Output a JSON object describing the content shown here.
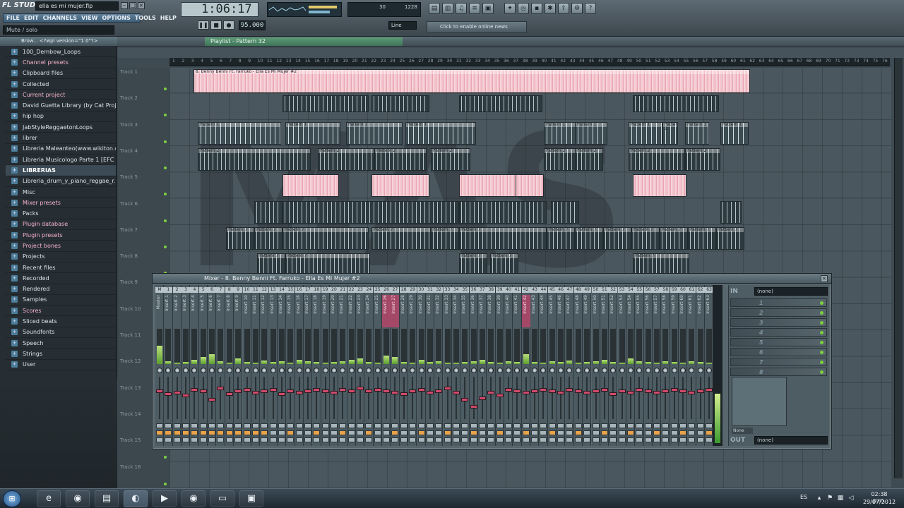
{
  "app": {
    "logo": "FL STUDIO",
    "project_file": "ella es mi mujer.flp",
    "hint": "Mute / solo",
    "menu": [
      "FILE",
      "EDIT",
      "CHANNELS",
      "VIEW",
      "OPTIONS",
      "TOOLS",
      "HELP"
    ],
    "time": "1:06:17",
    "tempo": "95.000",
    "cpu_a": "30",
    "cpu_b": "1228",
    "snap": "Line",
    "news": "Click to enable online news"
  },
  "browser": {
    "header": "Brow... <?wpl version=\"1.0\"?>",
    "items": [
      {
        "label": "100_Dembow_Loops",
        "hl": false
      },
      {
        "label": "Channel presets",
        "hl": true
      },
      {
        "label": "Clipboard files",
        "hl": false
      },
      {
        "label": "Collected",
        "hl": false
      },
      {
        "label": "Current project",
        "hl": true
      },
      {
        "label": "David Guetta Library (by Cat Proje...",
        "hl": false
      },
      {
        "label": "hip hop",
        "hl": false
      },
      {
        "label": "JabStyleReggaetonLoops",
        "hl": false
      },
      {
        "label": "librer",
        "hl": false
      },
      {
        "label": "Libreria Maleanteo(www.wikiton.o...",
        "hl": false
      },
      {
        "label": "Libreria Musicologo Parte 1 [EFC I...",
        "hl": false
      },
      {
        "label": "LIBRERIAS",
        "hl": false,
        "sel": true
      },
      {
        "label": "Libreria_drum_y_piano_reggae_r...",
        "hl": false
      },
      {
        "label": "Misc",
        "hl": false
      },
      {
        "label": "Mixer presets",
        "hl": true
      },
      {
        "label": "Packs",
        "hl": false
      },
      {
        "label": "Plugin database",
        "hl": true
      },
      {
        "label": "Plugin presets",
        "hl": true
      },
      {
        "label": "Project bones",
        "hl": true
      },
      {
        "label": "Projects",
        "hl": false
      },
      {
        "label": "Recent files",
        "hl": false
      },
      {
        "label": "Recorded",
        "hl": false
      },
      {
        "label": "Rendered",
        "hl": false
      },
      {
        "label": "Samples",
        "hl": false
      },
      {
        "label": "Scores",
        "hl": true
      },
      {
        "label": "Sliced beats",
        "hl": false
      },
      {
        "label": "Soundfonts",
        "hl": false
      },
      {
        "label": "Speech",
        "hl": false
      },
      {
        "label": "Strings",
        "hl": false
      },
      {
        "label": "User",
        "hl": false
      }
    ]
  },
  "playlist": {
    "title": "Playlist - Pattern 32",
    "ruler": [
      "1",
      "2",
      "3",
      "4",
      "5",
      "6",
      "7",
      "8",
      "9",
      "10",
      "11",
      "12",
      "13",
      "14",
      "15",
      "16",
      "17",
      "18",
      "19",
      "20",
      "21",
      "22",
      "23",
      "24",
      "25",
      "26",
      "27",
      "28",
      "29",
      "30",
      "31",
      "32",
      "33",
      "34",
      "35",
      "36",
      "37",
      "38",
      "39",
      "40",
      "41",
      "42",
      "43",
      "44",
      "45",
      "46",
      "47",
      "48",
      "49",
      "50",
      "51",
      "52",
      "53",
      "54",
      "55",
      "56",
      "57",
      "58",
      "59",
      "60",
      "61",
      "62",
      "63",
      "64",
      "65",
      "66",
      "67",
      "68",
      "69",
      "70",
      "71",
      "72",
      "73",
      "74",
      "75",
      "76"
    ],
    "tracks": [
      "Track 1",
      "Track 2",
      "Track 3",
      "Track 4",
      "Track 5",
      "Track 6",
      "Track 7",
      "Track 8",
      "Track 9",
      "Track 10",
      "Track 11",
      "Track 12",
      "Track 13",
      "Track 14",
      "Track 15",
      "Track 16"
    ],
    "audio_clip": "8. Benny Benni Ft. Farruko - Ella Es Mi Mujer #2",
    "pattern_clips": [
      "Pattern 1",
      "Pattern 2",
      "Pattern 7"
    ],
    "watermark": "MAS"
  },
  "mixer": {
    "title": "Mixer - 8. Benny Benni Ft. Farruko - Ella Es Mi Mujer #2",
    "strip_names": [
      "Master",
      "Insert 1",
      "Insert 2",
      "Insert 3",
      "Insert 4",
      "Insert 5",
      "Insert 6",
      "Insert 7",
      "Insert 8",
      "Insert 9",
      "Insert 10",
      "Insert 11",
      "Insert 12",
      "Insert 13",
      "Insert 14",
      "Insert 15",
      "Insert 16",
      "Insert 17",
      "Insert 18",
      "Insert 19",
      "Insert 20",
      "Insert 21",
      "Insert 22",
      "Insert 23",
      "Insert 24",
      "Insert 25",
      "Insert 26",
      "Insert 27",
      "Insert 28",
      "Insert 29",
      "Insert 30",
      "Insert 31",
      "Insert 32",
      "Insert 33",
      "Insert 34",
      "Insert 35",
      "Insert 36",
      "Insert 37",
      "Insert 38",
      "Insert 39",
      "Insert 40",
      "Insert 41",
      "Insert 42",
      "Insert 43",
      "Insert 44",
      "Insert 45",
      "Insert 46",
      "Insert 47",
      "Insert 48",
      "Insert 49",
      "Insert 50",
      "Insert 51",
      "Insert 52",
      "Insert 53",
      "Insert 54",
      "Insert 55",
      "Insert 56",
      "Insert 57",
      "Insert 58",
      "Insert 59",
      "Insert 60",
      "Insert 61",
      "Insert 62",
      "Insert 63",
      "Send 1",
      "Send 2",
      "Send 3",
      "Send 4"
    ],
    "hot_strips": [
      26,
      27,
      42
    ],
    "in_label": "IN",
    "out_label": "OUT",
    "in_value": "(none)",
    "out_value": "(none)",
    "fx_slots": [
      "1",
      "2",
      "3",
      "4",
      "5",
      "6",
      "7",
      "8"
    ],
    "eq_value": "None"
  },
  "taskbar": {
    "apps": [
      "e",
      "◉",
      "▤",
      "◐",
      "▶",
      "◉",
      "▭",
      "▣"
    ],
    "active_app": 3,
    "language": "ES",
    "time": "02:38 p.m.",
    "date": "29/07/2012"
  }
}
